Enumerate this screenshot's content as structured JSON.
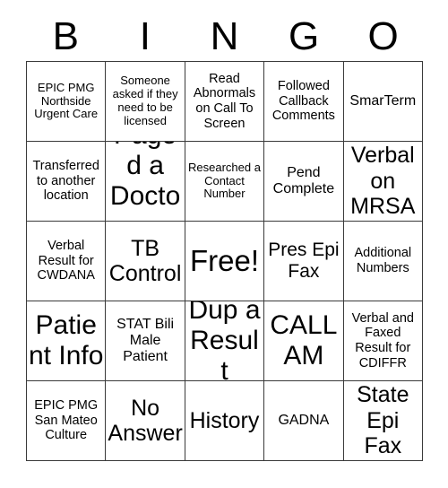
{
  "card": {
    "title_letters": [
      "B",
      "I",
      "N",
      "G",
      "O"
    ],
    "rows": [
      [
        {
          "text": "EPIC PMG Northside Urgent Care",
          "size": "xs"
        },
        {
          "text": "Someone asked if they need to be licensed",
          "size": "xs"
        },
        {
          "text": "Read Abnormals on Call To Screen",
          "size": "s"
        },
        {
          "text": "Followed Callback Comments",
          "size": "s"
        },
        {
          "text": "SmarTerm",
          "size": "m"
        }
      ],
      [
        {
          "text": "Transferred to another location",
          "size": "s"
        },
        {
          "text": "Paged a Doctor",
          "size": "xxl"
        },
        {
          "text": "Researched a Contact Number",
          "size": "xs"
        },
        {
          "text": "Pend Complete",
          "size": "m"
        },
        {
          "text": "Verbal on MRSA",
          "size": "xl"
        }
      ],
      [
        {
          "text": "Verbal Result for CWDANA",
          "size": "s"
        },
        {
          "text": "TB Control",
          "size": "xl"
        },
        {
          "text": "Free!",
          "size": "free"
        },
        {
          "text": "Pres Epi Fax",
          "size": "l"
        },
        {
          "text": "Additional Numbers",
          "size": "s"
        }
      ],
      [
        {
          "text": "Patient Info",
          "size": "xxl"
        },
        {
          "text": "STAT Bili Male Patient",
          "size": "m"
        },
        {
          "text": "Dup a Result",
          "size": "xxl"
        },
        {
          "text": "CALL AM",
          "size": "xxl"
        },
        {
          "text": "Verbal and Faxed Result for CDIFFR",
          "size": "s"
        }
      ],
      [
        {
          "text": "EPIC PMG San Mateo Culture",
          "size": "s"
        },
        {
          "text": "No Answer",
          "size": "xl"
        },
        {
          "text": "History",
          "size": "xl"
        },
        {
          "text": "GADNA",
          "size": "m"
        },
        {
          "text": "State Epi Fax",
          "size": "xl"
        }
      ]
    ]
  }
}
